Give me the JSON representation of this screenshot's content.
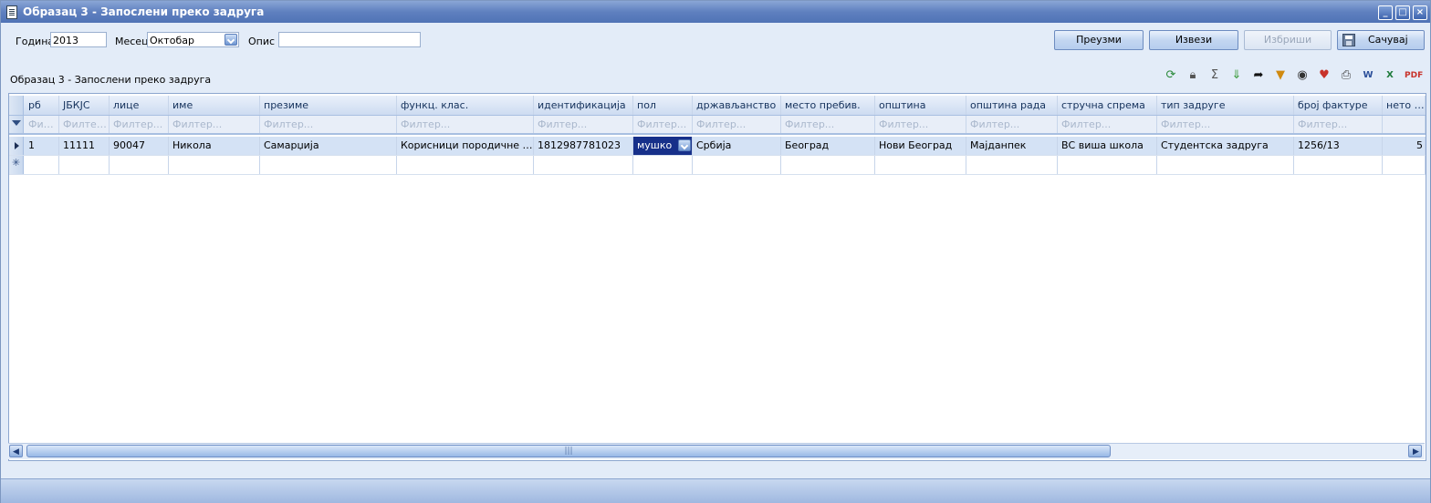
{
  "window": {
    "title": "Образац 3 - Запослени преко задруга"
  },
  "form": {
    "year_label": "Година",
    "year_value": "2013",
    "month_label": "Месец",
    "month_value": "Октобар",
    "description_label": "Опис",
    "description_value": ""
  },
  "actions": {
    "import_label": "Преузми",
    "export_label": "Извези",
    "delete_label": "Избриши",
    "save_label": "Сачувај"
  },
  "grid": {
    "caption": "Образац 3 - Запослени преко задруга",
    "columns": [
      "рб",
      "ЈБКЈС",
      "лице",
      "име",
      "презиме",
      "функц. клас.",
      "идентификација",
      "пол",
      "држављанство",
      "место пребив.",
      "општина",
      "општина рада",
      "стручна спрема",
      "тип задруге",
      "број фактуре",
      "нето на"
    ],
    "filter_placeholder": "Филтер...",
    "filter_short": "Фил...",
    "rows": [
      [
        "1",
        "11111",
        "90047",
        "Никола",
        "Самарџија",
        "Корисници породичне пен...",
        "1812987781023",
        "мушко",
        "Србија",
        "Београд",
        "Нови Београд",
        "Мајданпек",
        "ВС виша школа",
        "Студентска задруга",
        "1256/13",
        "5"
      ]
    ],
    "toolbar_icons": [
      "refresh-icon",
      "lock-icon",
      "sum-icon",
      "expand-icon",
      "export-arrow-icon",
      "filter-icon",
      "view-icon",
      "favorite-icon",
      "print-icon",
      "word-icon",
      "excel-icon",
      "pdf-icon"
    ],
    "scroll_thumb_grip": "|||"
  }
}
